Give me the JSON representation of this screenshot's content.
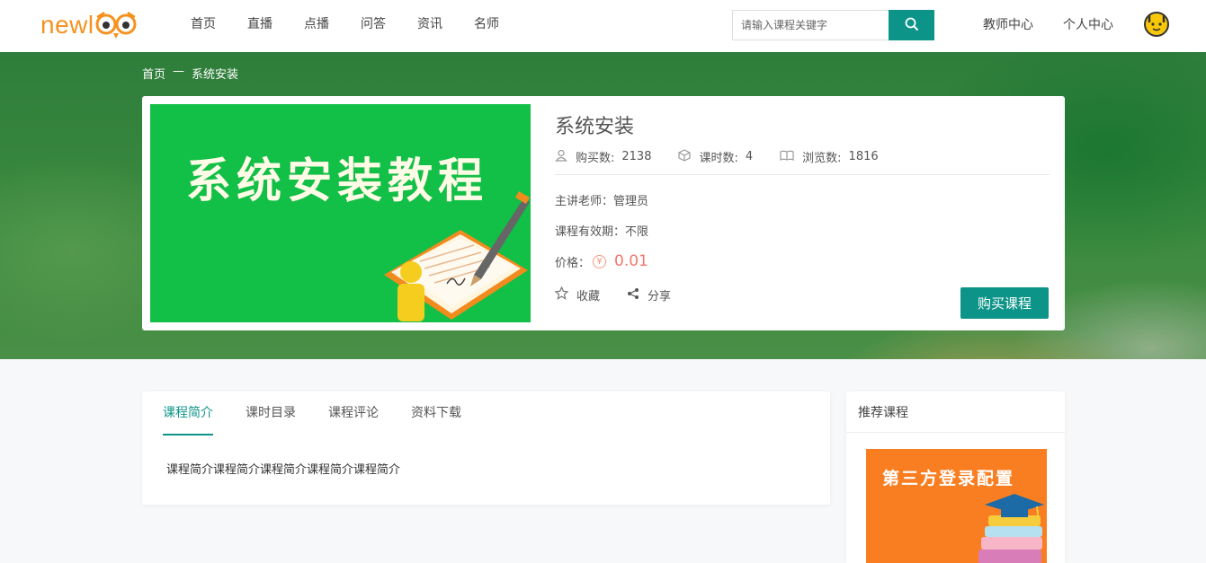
{
  "brand": {
    "logo_text": "newl",
    "logo_icon": "owl-eyes-logo-icon"
  },
  "nav": {
    "items": [
      "首页",
      "直播",
      "点播",
      "问答",
      "资讯",
      "名师"
    ]
  },
  "search": {
    "placeholder": "请输入课程关键字",
    "button_icon": "search-icon"
  },
  "header_links": {
    "teacher_center": "教师中心",
    "personal_center": "个人中心"
  },
  "breadcrumb": {
    "home": "首页",
    "separator": "—",
    "current": "系统安装"
  },
  "course": {
    "cover_title": "系统安装教程",
    "title": "系统安装",
    "stats": [
      {
        "icon": "user-icon",
        "label": "购买数:",
        "value": "2138"
      },
      {
        "icon": "cube-icon",
        "label": "课时数:",
        "value": "4"
      },
      {
        "icon": "book-icon",
        "label": "浏览数:",
        "value": "1816"
      }
    ],
    "teacher": "主讲老师：管理员",
    "validity": "课程有效期：不限",
    "price_label": "价格：",
    "currency_symbol": "¥",
    "price": "0.01",
    "favorite": "收藏",
    "share": "分享",
    "buy_button": "购买课程"
  },
  "tabs": {
    "items": [
      "课程简介",
      "课时目录",
      "课程评论",
      "资料下载"
    ],
    "active_index": 0,
    "content": "课程简介课程简介课程简介课程简介课程简介"
  },
  "recommend": {
    "title": "推荐课程",
    "card_title": "第三方登录配置"
  },
  "colors": {
    "accent": "#0d9488",
    "brand_orange": "#f5921e",
    "price": "#f4766a",
    "cover_green": "#12bf47",
    "rec_orange": "#f97e22"
  }
}
